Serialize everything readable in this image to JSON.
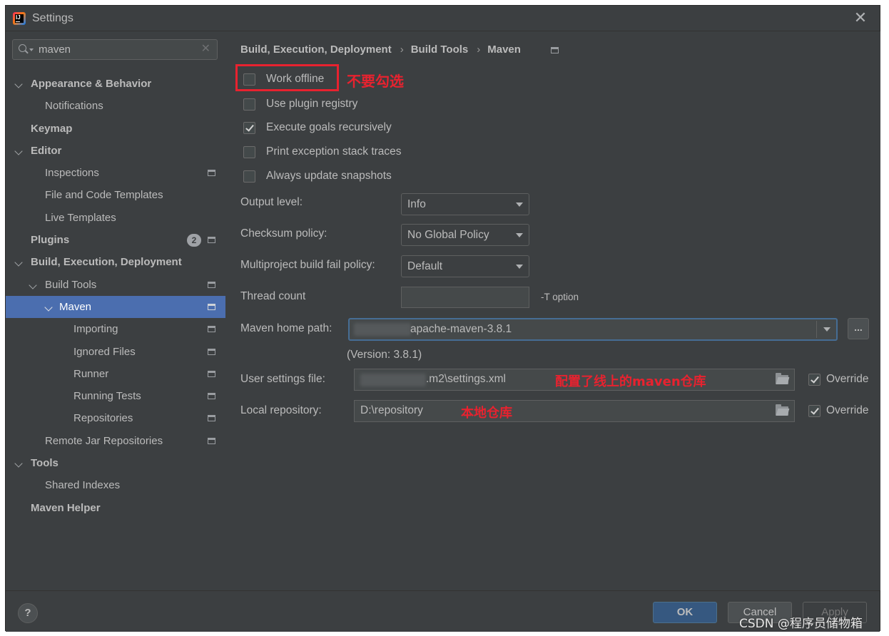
{
  "window": {
    "title": "Settings"
  },
  "search": {
    "value": "maven"
  },
  "tree": [
    {
      "label": "Appearance & Behavior",
      "level": 0,
      "expanded": true,
      "bold": true
    },
    {
      "label": "Notifications",
      "level": 1
    },
    {
      "label": "Keymap",
      "level": 0,
      "bold": true
    },
    {
      "label": "Editor",
      "level": 0,
      "expanded": true,
      "bold": true
    },
    {
      "label": "Inspections",
      "level": 1,
      "project_icon": true
    },
    {
      "label": "File and Code Templates",
      "level": 1
    },
    {
      "label": "Live Templates",
      "level": 1
    },
    {
      "label": "Plugins",
      "level": 0,
      "bold": true,
      "badge": "2",
      "project_icon": true
    },
    {
      "label": "Build, Execution, Deployment",
      "level": 0,
      "expanded": true,
      "bold": true
    },
    {
      "label": "Build Tools",
      "level": 1,
      "expanded": true,
      "project_icon": true
    },
    {
      "label": "Maven",
      "level": 2,
      "expanded": true,
      "selected": true,
      "project_icon": true
    },
    {
      "label": "Importing",
      "level": 3,
      "project_icon": true
    },
    {
      "label": "Ignored Files",
      "level": 3,
      "project_icon": true
    },
    {
      "label": "Runner",
      "level": 3,
      "project_icon": true
    },
    {
      "label": "Running Tests",
      "level": 3,
      "project_icon": true
    },
    {
      "label": "Repositories",
      "level": 3,
      "project_icon": true
    },
    {
      "label": "Remote Jar Repositories",
      "level": 1,
      "project_icon": true
    },
    {
      "label": "Tools",
      "level": 0,
      "expanded": true,
      "bold": true
    },
    {
      "label": "Shared Indexes",
      "level": 1
    },
    {
      "label": "Maven Helper",
      "level": 0,
      "bold": true
    }
  ],
  "breadcrumb": [
    "Build, Execution, Deployment",
    "Build Tools",
    "Maven"
  ],
  "checkboxes": {
    "work_offline": {
      "label": "Work offline",
      "checked": false
    },
    "use_plugin_registry": {
      "label": "Use plugin registry",
      "checked": false
    },
    "execute_goals_recursively": {
      "label": "Execute goals recursively",
      "checked": true
    },
    "print_exception_stack_traces": {
      "label": "Print exception stack traces",
      "checked": false
    },
    "always_update_snapshots": {
      "label": "Always update snapshots",
      "checked": false
    }
  },
  "form": {
    "output_level": {
      "label": "Output level:",
      "value": "Info"
    },
    "checksum_policy": {
      "label": "Checksum policy:",
      "value": "No Global Policy"
    },
    "multiproject_fail_policy": {
      "label": "Multiproject build fail policy:",
      "value": "Default"
    },
    "thread_count": {
      "label": "Thread count",
      "value": "",
      "hint": "-T option"
    },
    "maven_home": {
      "label": "Maven home path:",
      "value": "apache-maven-3.8.1",
      "version": "(Version: 3.8.1)",
      "browse": "..."
    },
    "user_settings": {
      "label": "User settings file:",
      "value": ".m2\\settings.xml",
      "override_label": "Override",
      "override": true
    },
    "local_repo": {
      "label": "Local repository:",
      "value": "D:\\repository",
      "override_label": "Override",
      "override": true
    }
  },
  "annotations": {
    "work_offline": "不要勾选",
    "user_settings": "配置了线上的maven仓库",
    "local_repo": "本地仓库"
  },
  "footer": {
    "help": "?",
    "ok": "OK",
    "cancel": "Cancel",
    "apply": "Apply"
  },
  "watermark": "CSDN @程序员储物箱",
  "colors": {
    "background": "#3c3f41",
    "selection": "#4b6eaf",
    "annotation": "#e8222f",
    "ok_button": "#365880"
  }
}
